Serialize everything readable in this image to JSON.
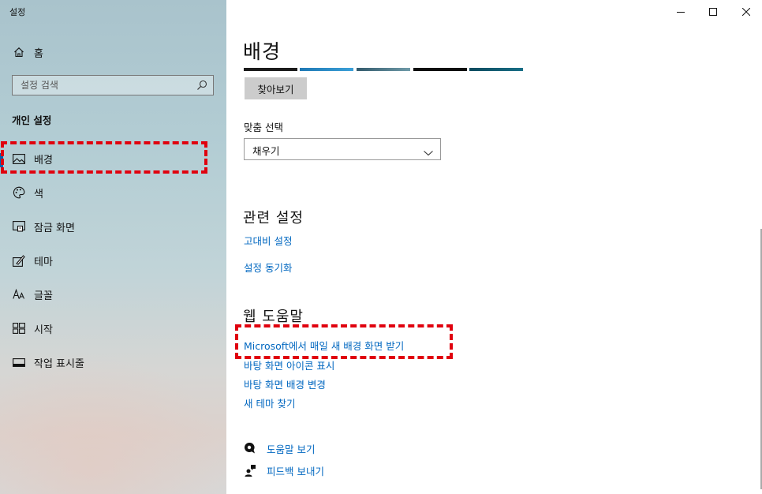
{
  "window": {
    "title": "설정"
  },
  "sidebar": {
    "home_label": "홈",
    "search_placeholder": "설정 검색",
    "section_heading": "개인 설정",
    "items": [
      {
        "label": "배경",
        "icon": "image-icon",
        "selected": true
      },
      {
        "label": "색",
        "icon": "palette-icon"
      },
      {
        "label": "잠금 화면",
        "icon": "lock-screen-icon"
      },
      {
        "label": "테마",
        "icon": "theme-icon"
      },
      {
        "label": "글꼴",
        "icon": "font-icon"
      },
      {
        "label": "시작",
        "icon": "start-icon"
      },
      {
        "label": "작업 표시줄",
        "icon": "taskbar-icon"
      }
    ]
  },
  "main": {
    "title": "배경",
    "browse_label": "찾아보기",
    "fit_label": "맞춤 선택",
    "fit_value": "채우기",
    "related": {
      "heading": "관련 설정",
      "links": [
        "고대비 설정",
        "설정 동기화"
      ]
    },
    "web": {
      "heading": "웹 도움말",
      "links": [
        "Microsoft에서 매일 새 배경 화면 받기",
        "바탕 화면 아이콘 표시",
        "바탕 화면 배경 변경",
        "새 테마 찾기"
      ]
    },
    "help": {
      "get_help": "도움말 보기",
      "feedback": "피드백 보내기"
    }
  },
  "colors": {
    "accent": "#0063b1",
    "link": "#0067c0",
    "highlight": "#e0000e"
  }
}
